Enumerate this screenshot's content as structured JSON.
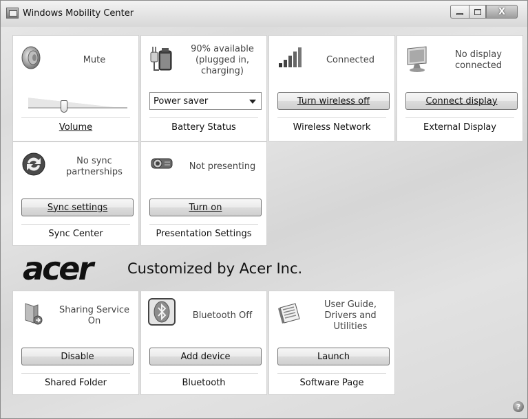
{
  "window": {
    "title": "Windows Mobility Center",
    "controls": {
      "minimize": "minimize",
      "maximize": "maximize",
      "close": "X"
    }
  },
  "tiles": {
    "volume": {
      "status": "Mute",
      "name": "Volume",
      "slider_level": 0.35
    },
    "battery": {
      "status": "90% available (plugged in, charging)",
      "control_value": "Power saver",
      "name": "Battery Status"
    },
    "wireless": {
      "status": "Connected",
      "control_label": "Turn wireless off",
      "name": "Wireless Network"
    },
    "display": {
      "status": "No display connected",
      "control_label": "Connect display",
      "name": "External Display"
    },
    "sync": {
      "status": "No sync partnerships",
      "control_label": "Sync settings",
      "name": "Sync Center"
    },
    "presentation": {
      "status": "Not presenting",
      "control_label": "Turn on",
      "name": "Presentation Settings"
    },
    "shared_folder": {
      "status": "Sharing Service On",
      "control_label": "Disable",
      "name": "Shared Folder"
    },
    "bluetooth": {
      "status": "Bluetooth Off",
      "control_label": "Add device",
      "name": "Bluetooth"
    },
    "software": {
      "status": "User Guide, Drivers and Utilities",
      "control_label": "Launch",
      "name": "Software Page"
    }
  },
  "brand": {
    "logo": "acer",
    "text": "Customized by Acer Inc."
  },
  "help": {
    "label": "?"
  }
}
